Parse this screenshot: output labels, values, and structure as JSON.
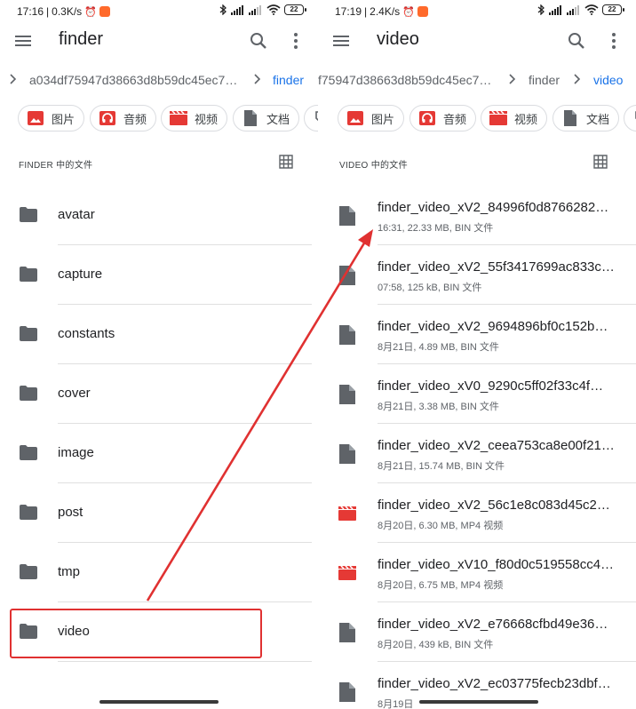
{
  "left": {
    "status": {
      "time": "17:16",
      "speed": "0.3K/s",
      "battery": "22"
    },
    "title": "finder",
    "breadcrumb": [
      "a034df75947d38663d8b59dc45ec7…",
      "finder"
    ],
    "chips": [
      "图片",
      "音频",
      "视频",
      "文档"
    ],
    "section_title": "FINDER 中的文件",
    "folders": [
      "avatar",
      "capture",
      "constants",
      "cover",
      "image",
      "post",
      "tmp",
      "video"
    ]
  },
  "right": {
    "status": {
      "time": "17:19",
      "speed": "2.4K/s",
      "battery": "22"
    },
    "title": "video",
    "breadcrumb": [
      "f75947d38663d8b59dc45ec7…",
      "finder",
      "video"
    ],
    "chips": [
      "图片",
      "音频",
      "视频",
      "文档"
    ],
    "section_title": "VIDEO 中的文件",
    "files": [
      {
        "name": "finder_video_xV2_84996f0d8766282…",
        "meta": "16:31, 22.33 MB, BIN 文件",
        "icon": "file-icon"
      },
      {
        "name": "finder_video_xV2_55f3417699ac833c…",
        "meta": "07:58, 125 kB, BIN 文件",
        "icon": "file-icon"
      },
      {
        "name": "finder_video_xV2_9694896bf0c152b…",
        "meta": "8月21日, 4.89 MB, BIN 文件",
        "icon": "file-icon"
      },
      {
        "name": "finder_video_xV0_9290c5ff02f33c4f…",
        "meta": "8月21日, 3.38 MB, BIN 文件",
        "icon": "file-icon"
      },
      {
        "name": "finder_video_xV2_ceea753ca8e00f21…",
        "meta": "8月21日, 15.74 MB, BIN 文件",
        "icon": "file-icon"
      },
      {
        "name": "finder_video_xV2_56c1e8c083d45c2…",
        "meta": "8月20日, 6.30 MB, MP4 视频",
        "icon": "video-icon"
      },
      {
        "name": "finder_video_xV10_f80d0c519558cc4…",
        "meta": "8月20日, 6.75 MB, MP4 视频",
        "icon": "video-icon"
      },
      {
        "name": "finder_video_xV2_e76668cfbd49e36…",
        "meta": "8月20日, 439 kB, BIN 文件",
        "icon": "file-icon"
      },
      {
        "name": "finder_video_xV2_ec03775fecb23dbf…",
        "meta": "8月19日",
        "icon": "file-icon"
      }
    ]
  },
  "colors": {
    "accent": "#1a73e8",
    "annotation": "#e03131",
    "image_chip": "#e53935",
    "audio_chip": "#e53935",
    "video_chip": "#e53935",
    "doc_chip": "#5f6368",
    "folder_icon": "#5f6368"
  }
}
